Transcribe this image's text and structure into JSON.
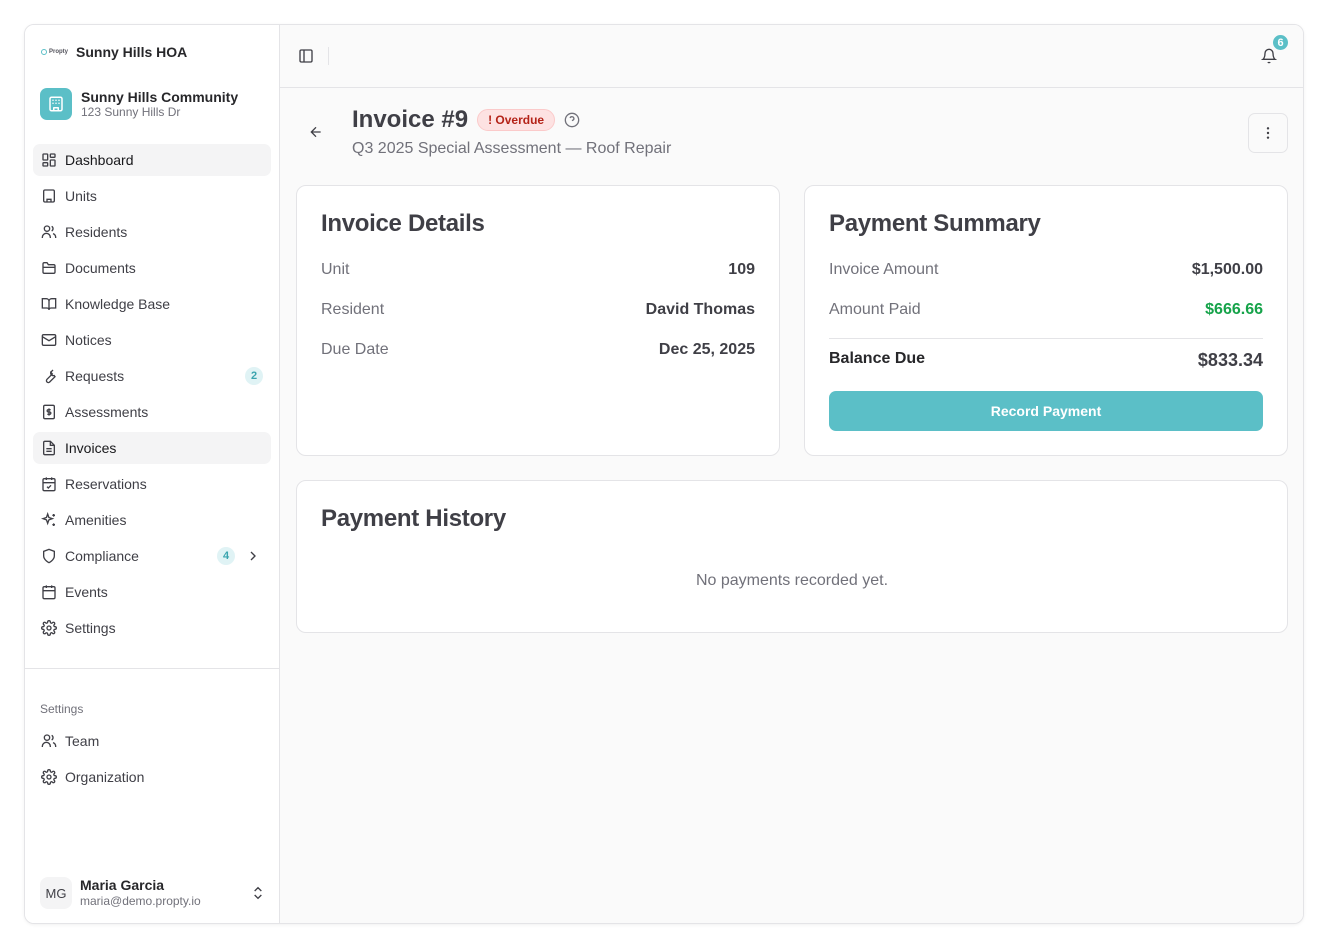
{
  "brand": {
    "logo_text": "Propty",
    "name": "Sunny Hills HOA"
  },
  "community": {
    "name": "Sunny Hills Community",
    "address": "123 Sunny Hills Dr"
  },
  "nav": [
    {
      "label": "Dashboard",
      "icon": "dashboard-icon"
    },
    {
      "label": "Units",
      "icon": "building-icon"
    },
    {
      "label": "Residents",
      "icon": "users-icon"
    },
    {
      "label": "Documents",
      "icon": "folder-icon"
    },
    {
      "label": "Knowledge Base",
      "icon": "book-icon"
    },
    {
      "label": "Notices",
      "icon": "mail-icon"
    },
    {
      "label": "Requests",
      "icon": "wrench-icon",
      "badge": "2"
    },
    {
      "label": "Assessments",
      "icon": "dollar-icon"
    },
    {
      "label": "Invoices",
      "icon": "file-icon"
    },
    {
      "label": "Reservations",
      "icon": "calendar-check-icon"
    },
    {
      "label": "Amenities",
      "icon": "sparkles-icon"
    },
    {
      "label": "Compliance",
      "icon": "shield-icon",
      "badge": "4"
    },
    {
      "label": "Events",
      "icon": "calendar-icon"
    },
    {
      "label": "Settings",
      "icon": "gear-icon"
    }
  ],
  "settings_section": {
    "label": "Settings",
    "items": [
      {
        "label": "Team",
        "icon": "users-icon"
      },
      {
        "label": "Organization",
        "icon": "gear-icon"
      }
    ]
  },
  "user": {
    "initials": "MG",
    "name": "Maria Garcia",
    "email": "maria@demo.propty.io"
  },
  "topbar": {
    "notification_count": "6"
  },
  "invoice": {
    "title": "Invoice #9",
    "status": "! Overdue",
    "subtitle": "Q3 2025 Special Assessment — Roof Repair"
  },
  "details": {
    "title": "Invoice Details",
    "rows": [
      {
        "label": "Unit",
        "value": "109"
      },
      {
        "label": "Resident",
        "value": "David Thomas"
      },
      {
        "label": "Due Date",
        "value": "Dec 25, 2025"
      }
    ]
  },
  "summary": {
    "title": "Payment Summary",
    "invoice_amount_label": "Invoice Amount",
    "invoice_amount": "$1,500.00",
    "amount_paid_label": "Amount Paid",
    "amount_paid": "$666.66",
    "balance_label": "Balance Due",
    "balance": "$833.34",
    "button": "Record Payment"
  },
  "history": {
    "title": "Payment History",
    "empty": "No payments recorded yet."
  },
  "colors": {
    "accent": "#5bbfc7",
    "paid_green": "#16a34a",
    "overdue_red": "#b42318"
  }
}
